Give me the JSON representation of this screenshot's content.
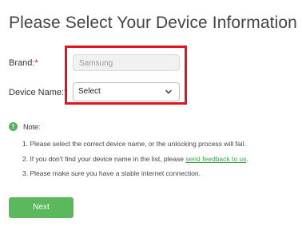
{
  "title": "Please Select Your Device Information",
  "form": {
    "brand_label": "Brand:",
    "brand_required": "*",
    "brand_value": "Samsung",
    "device_label": "Device Name:",
    "device_required": "*",
    "device_selected": "Select"
  },
  "note": {
    "heading": "Note:",
    "icon": "info-icon",
    "item1": "1. Please select the correct device name, or the unlocking process will fail.",
    "item2_prefix": "2. If you don't find your device name in the list, please ",
    "item2_link": "send feedback to us",
    "item2_suffix": ".",
    "item3": "3. Please make sure you have a stable internet connection."
  },
  "actions": {
    "next_label": "Next"
  },
  "colors": {
    "highlight": "#e1151e",
    "accent_green": "#5cb85c",
    "link_green": "#3aa34a"
  }
}
